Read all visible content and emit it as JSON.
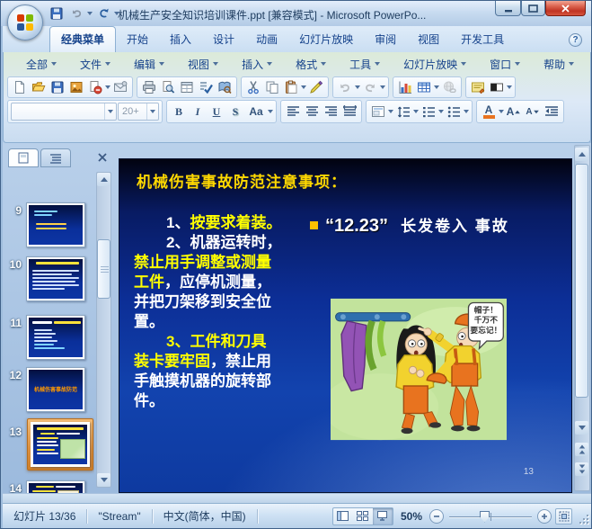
{
  "window": {
    "title": "机械生产安全知识培训课件.ppt [兼容模式] - Microsoft PowerPo..."
  },
  "ribbon": {
    "tabs": [
      "经典菜单",
      "开始",
      "插入",
      "设计",
      "动画",
      "幻灯片放映",
      "审阅",
      "视图",
      "开发工具"
    ],
    "active_tab": "经典菜单",
    "help_icon": "?"
  },
  "menubar": {
    "items": [
      "全部",
      "文件",
      "编辑",
      "视图",
      "插入",
      "格式",
      "工具",
      "幻灯片放映",
      "窗口",
      "帮助"
    ]
  },
  "toolbar": {
    "row1_icons": [
      "new",
      "open",
      "save",
      "publish",
      "permission",
      "mail",
      "print",
      "print-preview",
      "page-setup",
      "spelling",
      "research",
      "cut",
      "copy",
      "paste",
      "format-painter",
      "undo",
      "redo",
      "chart",
      "table",
      "hyperlink",
      "slide-design",
      "color-view"
    ],
    "row2_icons": [
      "font-name",
      "font-size",
      "bold",
      "italic",
      "underline",
      "shadow",
      "change-case",
      "align-left",
      "align-center",
      "align-right",
      "justify",
      "layout",
      "line-spacing",
      "numbering",
      "bullets",
      "font-color",
      "grow-font",
      "shrink-font",
      "decrease-indent"
    ],
    "font_name": "",
    "font_size": "20+",
    "bold": "B",
    "italic": "I",
    "underline": "U",
    "shadow": "S",
    "change_case": "Aa",
    "font_color": "A",
    "grow_font": "A",
    "shrink_font": "A"
  },
  "sidebar": {
    "selected_slide": "13",
    "slides": [
      {
        "n": "9"
      },
      {
        "n": "10"
      },
      {
        "n": "11"
      },
      {
        "n": "12",
        "title": "机械伤害事故防范"
      },
      {
        "n": "13"
      },
      {
        "n": "14"
      }
    ]
  },
  "slide": {
    "title": "机械伤害事故防范注意事项：",
    "body_lines": [
      {
        "w": "1、",
        "y": "按要求着装。"
      },
      {
        "w": "2、机器运转时，"
      },
      {
        "y": "禁止用手调整或测量"
      },
      {
        "y": "工件",
        "w": "，应停机测量，"
      },
      {
        "w": "并把刀架移到安全位"
      },
      {
        "w": "置。"
      },
      {
        "y": "3、工件和刀具"
      },
      {
        "y": "装卡要牢固",
        "w": "，禁止用"
      },
      {
        "w": "手触摸机器的旋转部"
      },
      {
        "w": "件。"
      }
    ],
    "callout": {
      "number": "“12.23”",
      "text": "长发卷入 事故"
    },
    "cartoon": {
      "speech": [
        "帽子！",
        "千万不",
        "要忘记！"
      ]
    },
    "page_number": "13",
    "colors": {
      "title": "#ffd800",
      "highlight": "#ffff00",
      "body": "#ffffff",
      "bullet": "#ffc000"
    }
  },
  "statusbar": {
    "slide_info": "幻灯片 13/36",
    "theme": "\"Stream\"",
    "language": "中文(简体，中国)",
    "zoom_level": "50%"
  }
}
